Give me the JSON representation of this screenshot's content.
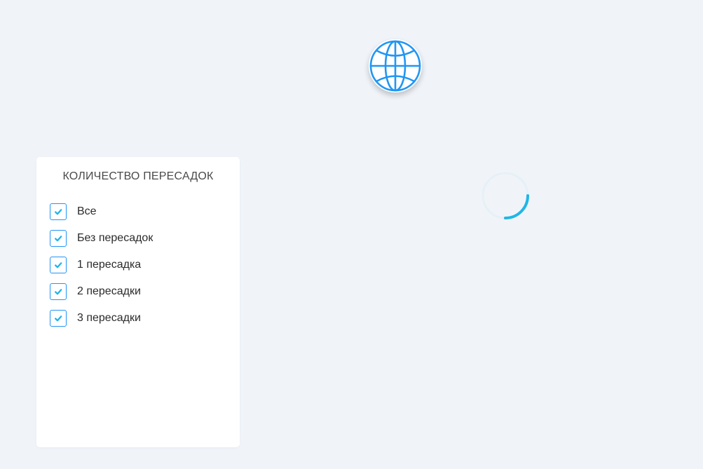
{
  "logo": {
    "icon": "globe-icon",
    "color": "#2196f3"
  },
  "filter": {
    "title": "Количество пересадок",
    "options": [
      {
        "label": "Все",
        "checked": true
      },
      {
        "label": "Без пересадок",
        "checked": true
      },
      {
        "label": "1 пересадка",
        "checked": true
      },
      {
        "label": "2 пересадки",
        "checked": true
      },
      {
        "label": "3 пересадки",
        "checked": true
      }
    ]
  },
  "loader": {
    "icon": "loading-spinner-icon",
    "color": "#1fb6e6"
  },
  "colors": {
    "background": "#f0f4f9",
    "accent": "#2196f3",
    "checkmark": "#1fb6e6"
  }
}
